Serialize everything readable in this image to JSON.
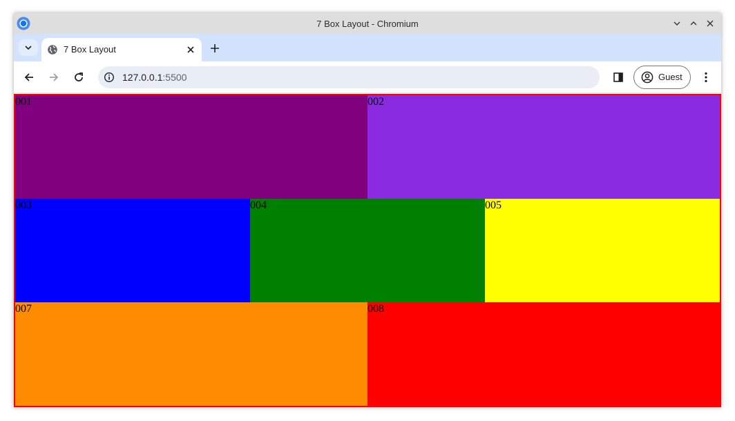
{
  "window": {
    "title": "7 Box Layout - Chromium"
  },
  "tabs": [
    {
      "title": "7 Box Layout"
    }
  ],
  "toolbar": {
    "url_host": "127.0.0.1",
    "url_port": ":5500",
    "guest_label": "Guest"
  },
  "boxes": [
    {
      "label": "001",
      "color": "#800080"
    },
    {
      "label": "002",
      "color": "#8a2be2"
    },
    {
      "label": "003",
      "color": "#0000ff"
    },
    {
      "label": "004",
      "color": "#008000"
    },
    {
      "label": "005",
      "color": "#ffff00"
    },
    {
      "label": "007",
      "color": "#ff8c00"
    },
    {
      "label": "008",
      "color": "#ff0000"
    }
  ],
  "colors": {
    "page_border": "#ff0000",
    "tabstrip": "#d3e3fd",
    "titlebar": "#dedede"
  },
  "icons": [
    "chromium-icon",
    "minimize-icon",
    "maximize-icon",
    "close-icon",
    "tab-search-icon",
    "globe-icon",
    "tab-close-icon",
    "new-tab-icon",
    "back-icon",
    "forward-icon",
    "reload-icon",
    "info-icon",
    "side-panel-icon",
    "account-icon",
    "menu-icon"
  ]
}
